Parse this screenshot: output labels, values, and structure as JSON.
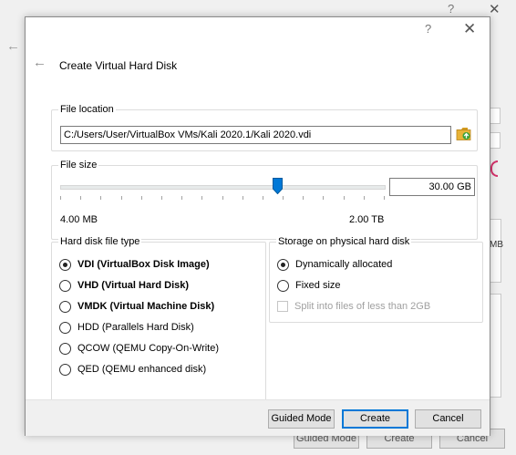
{
  "background": {
    "help_glyph": "?",
    "close_glyph": "✕",
    "back_glyph": "←",
    "fragment_text": "MB",
    "buttons": [
      "Guided Mode",
      "Create",
      "Cancel"
    ]
  },
  "dialog": {
    "help_glyph": "?",
    "close_glyph": "✕",
    "back_glyph": "←",
    "title": "Create Virtual Hard Disk",
    "file_location": {
      "label": "File location",
      "path": "C:/Users/User/VirtualBox VMs/Kali 2020.1/Kali 2020.vdi",
      "folder_icon": "folder-icon"
    },
    "file_size": {
      "label": "File size",
      "value": "30.00 GB",
      "min_label": "4.00 MB",
      "max_label": "2.00 TB",
      "slider_fraction": 0.67
    },
    "file_type": {
      "label": "Hard disk file type",
      "options": [
        {
          "label": "VDI (VirtualBox Disk Image)",
          "checked": true
        },
        {
          "label": "VHD (Virtual Hard Disk)",
          "checked": false
        },
        {
          "label": "VMDK (Virtual Machine Disk)",
          "checked": false
        },
        {
          "label": "HDD (Parallels Hard Disk)",
          "checked": false
        },
        {
          "label": "QCOW (QEMU Copy-On-Write)",
          "checked": false
        },
        {
          "label": "QED (QEMU enhanced disk)",
          "checked": false
        }
      ]
    },
    "storage": {
      "label": "Storage on physical hard disk",
      "options": [
        {
          "label": "Dynamically allocated",
          "checked": true
        },
        {
          "label": "Fixed size",
          "checked": false
        }
      ],
      "split_label": "Split into files of less than 2GB",
      "split_enabled": false
    },
    "buttons": {
      "guided": "Guided Mode",
      "create": "Create",
      "cancel": "Cancel"
    }
  },
  "colors": {
    "accent": "#0078d7",
    "slider_thumb": "#0078d7",
    "folder_yellow": "#e8b337",
    "folder_green": "#3aa23a"
  }
}
